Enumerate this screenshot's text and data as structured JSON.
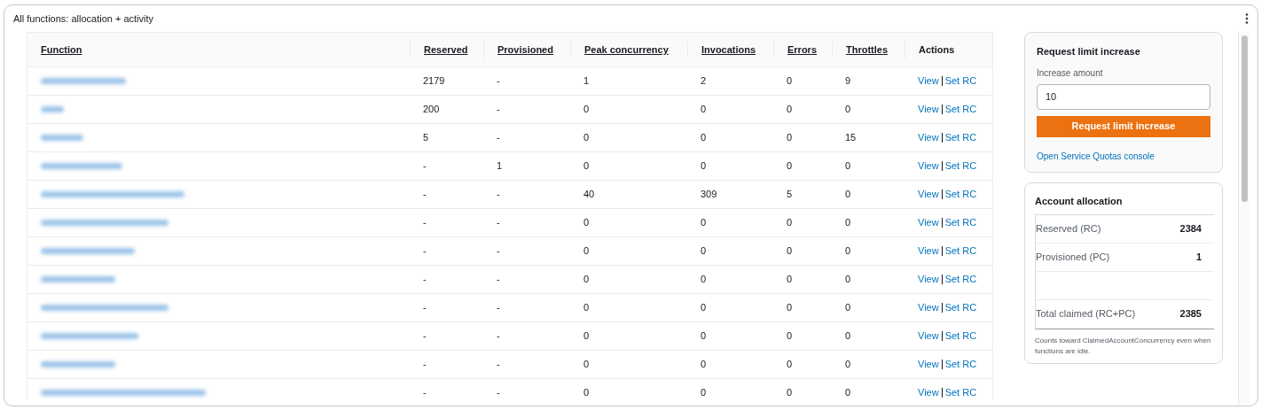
{
  "panel": {
    "title": "All functions: allocation + activity"
  },
  "table": {
    "columns": [
      "Function",
      "Reserved",
      "Provisioned",
      "Peak concurrency",
      "Invocations",
      "Errors",
      "Throttles",
      "Actions"
    ],
    "rows": [
      {
        "function_redacted": true,
        "reserved": "2179",
        "provisioned": "-",
        "peak": "1",
        "invocations": "2",
        "errors": "0",
        "throttles": "9",
        "actions": [
          "View",
          "Set RC"
        ]
      },
      {
        "function_redacted": true,
        "reserved": "200",
        "provisioned": "-",
        "peak": "0",
        "invocations": "0",
        "errors": "0",
        "throttles": "0",
        "actions": [
          "View",
          "Set RC"
        ]
      },
      {
        "function_redacted": true,
        "reserved": "5",
        "provisioned": "-",
        "peak": "0",
        "invocations": "0",
        "errors": "0",
        "throttles": "15",
        "actions": [
          "View",
          "Set RC"
        ]
      },
      {
        "function_redacted": true,
        "reserved": "-",
        "provisioned": "1",
        "peak": "0",
        "invocations": "0",
        "errors": "0",
        "throttles": "0",
        "actions": [
          "View",
          "Set RC"
        ]
      },
      {
        "function_redacted": true,
        "reserved": "-",
        "provisioned": "-",
        "peak": "40",
        "invocations": "309",
        "errors": "5",
        "throttles": "0",
        "actions": [
          "View",
          "Set RC"
        ]
      },
      {
        "function_redacted": true,
        "reserved": "-",
        "provisioned": "-",
        "peak": "0",
        "invocations": "0",
        "errors": "0",
        "throttles": "0",
        "actions": [
          "View",
          "Set RC"
        ]
      },
      {
        "function_redacted": true,
        "reserved": "-",
        "provisioned": "-",
        "peak": "0",
        "invocations": "0",
        "errors": "0",
        "throttles": "0",
        "actions": [
          "View",
          "Set RC"
        ]
      },
      {
        "function_redacted": true,
        "reserved": "-",
        "provisioned": "-",
        "peak": "0",
        "invocations": "0",
        "errors": "0",
        "throttles": "0",
        "actions": [
          "View",
          "Set RC"
        ]
      },
      {
        "function_redacted": true,
        "reserved": "-",
        "provisioned": "-",
        "peak": "0",
        "invocations": "0",
        "errors": "0",
        "throttles": "0",
        "actions": [
          "View",
          "Set RC"
        ]
      },
      {
        "function_redacted": true,
        "reserved": "-",
        "provisioned": "-",
        "peak": "0",
        "invocations": "0",
        "errors": "0",
        "throttles": "0",
        "actions": [
          "View",
          "Set RC"
        ]
      },
      {
        "function_redacted": true,
        "reserved": "-",
        "provisioned": "-",
        "peak": "0",
        "invocations": "0",
        "errors": "0",
        "throttles": "0",
        "actions": [
          "View",
          "Set RC"
        ]
      },
      {
        "function_redacted": true,
        "reserved": "-",
        "provisioned": "-",
        "peak": "0",
        "invocations": "0",
        "errors": "0",
        "throttles": "0",
        "actions": [
          "View",
          "Set RC"
        ]
      }
    ]
  },
  "limit_card": {
    "title": "Request limit increase",
    "field_label": "Increase amount",
    "field_value": "10",
    "button": "Request limit increase",
    "link": "Open Service Quotas console"
  },
  "allocation_card": {
    "title": "Account allocation",
    "rows": [
      {
        "label": "Reserved (RC)",
        "value": "2384"
      },
      {
        "label": "Provisioned (PC)",
        "value": "1"
      },
      {
        "label": "",
        "value": ""
      },
      {
        "label": "Total claimed (RC+PC)",
        "value": "2385"
      }
    ],
    "note": "Counts toward ClaimedAccountConcurrency even when functions are idle."
  }
}
